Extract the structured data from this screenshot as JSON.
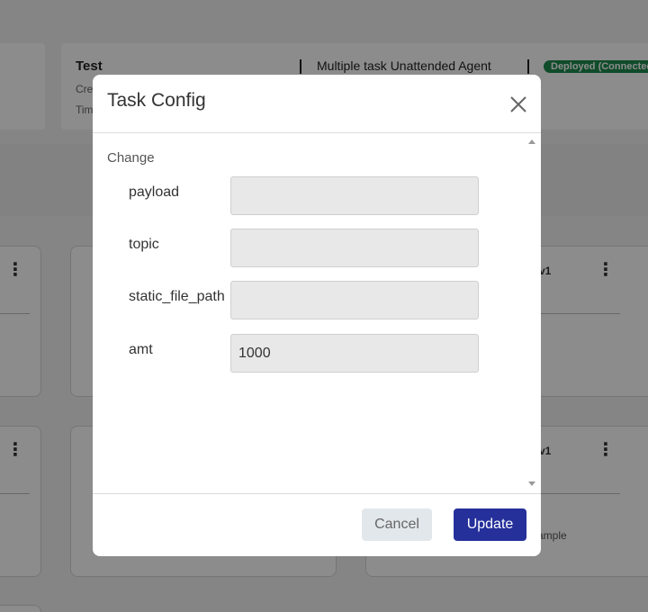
{
  "background": {
    "test_card": {
      "title": "Test",
      "line1": "Cre",
      "line2": "Tim",
      "agent": "Multiple task Unattended Agent",
      "status": "Deployed (Connected)"
    },
    "cards": {
      "version_label_1": "v1",
      "version_label_2": "v1",
      "sample_text": "ample"
    }
  },
  "modal": {
    "title": "Task Config",
    "section_label": "Change",
    "fields": [
      {
        "label": "payload",
        "value": "",
        "placeholder": ""
      },
      {
        "label": "topic",
        "value": "",
        "placeholder": ""
      },
      {
        "label": "static_file_path",
        "value": "",
        "placeholder": ""
      },
      {
        "label": "amt",
        "value": "1000",
        "placeholder": ""
      }
    ],
    "cancel_label": "Cancel",
    "update_label": "Update"
  },
  "colors": {
    "primary": "#25309b",
    "badge_green": "#1e8a4e",
    "cancel_bg": "#e2e7ec"
  },
  "icons": {
    "close": "close-icon",
    "kebab": "more-vertical-icon"
  }
}
